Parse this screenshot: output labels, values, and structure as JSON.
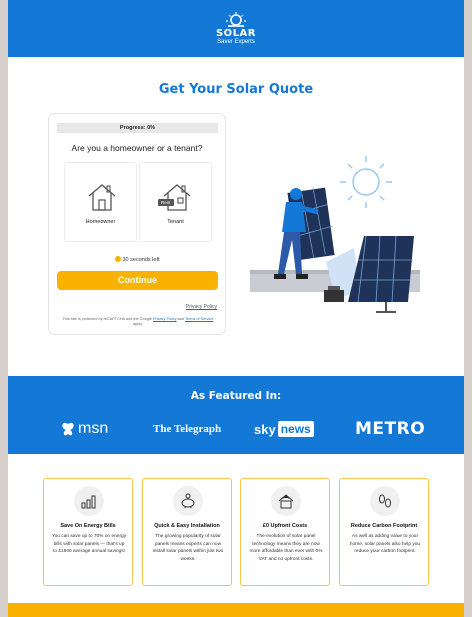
{
  "header": {
    "logo_title": "SOLAR",
    "logo_subtitle": "Saver Experts"
  },
  "quote": {
    "title": "Get Your Solar Quote",
    "progress_label": "Progress: 0%",
    "progress": 0,
    "question": "Are you a homeowner or a tenant?",
    "options": [
      {
        "label": "Homeowner",
        "icon": "house-icon"
      },
      {
        "label": "Tenant",
        "icon": "rent-house-icon",
        "tag": "Rent"
      }
    ],
    "timer": "30 seconds left",
    "continue_label": "Continue",
    "privacy_link": "Privacy Policy",
    "recaptcha_prefix": "This site is protected by reCAPTCHA and the Google",
    "recaptcha_privacy": "Privacy Policy",
    "recaptcha_and": "and",
    "recaptcha_terms": "Terms of Service",
    "recaptcha_suffix": "apply."
  },
  "featured": {
    "title": "As Featured In:",
    "brands": [
      "msn",
      "The Telegraph",
      "sky",
      "news",
      "METRO"
    ]
  },
  "benefits": [
    {
      "icon": "bar-chart-icon",
      "title": "Save On Energy Bills",
      "text": "You can save up to 70% on energy bills with solar panels — that's up to £1900 average annual savings!"
    },
    {
      "icon": "piggy-bank-icon",
      "title": "Quick & Easy Installation",
      "text": "The growing popularity of solar panels means experts can now install solar panels within just two weeks."
    },
    {
      "icon": "solar-house-icon",
      "title": "£0 Upfront Costs",
      "text": "The evolution of solar panel technology means they are now more affordable than ever with 0% VAT and no upfront costs."
    },
    {
      "icon": "footprint-icon",
      "title": "Reduce Carbon Footprint",
      "text": "As well as adding value to your home, solar panels also help you reduce your carbon footprint."
    }
  ],
  "colors": {
    "brand_blue": "#1479d6",
    "accent_yellow": "#f9b200"
  }
}
